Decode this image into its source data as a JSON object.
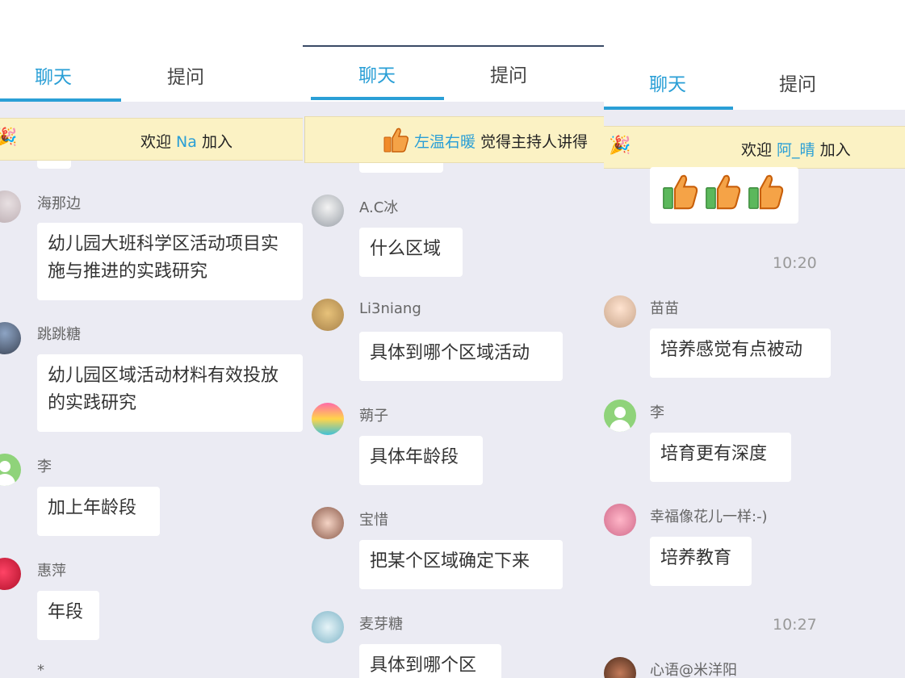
{
  "tabs": {
    "chat": "聊天",
    "ask": "提问"
  },
  "colors": {
    "accent": "#2a9fd6",
    "notice_bg": "#fbf2c4",
    "chat_bg": "#ebebf3"
  },
  "panel1": {
    "notice": {
      "prefix": "欢迎 ",
      "user": "Na",
      "suffix": " 加入"
    },
    "messages": [
      {
        "user": "海那边",
        "text": "幼儿园大班科学区活动项目实施与推进的实践研究"
      },
      {
        "user": "跳跳糖",
        "text": "幼儿园区域活动材料有效投放的实践研究"
      },
      {
        "user": "李",
        "text": "加上年龄段"
      },
      {
        "user": "惠萍",
        "text": "年段"
      },
      {
        "user": "*"
      }
    ]
  },
  "panel2": {
    "notice": {
      "user": "左温右暖",
      "suffix": " 觉得主持人讲得"
    },
    "messages": [
      {
        "user": "A.C冰",
        "text": "什么区域"
      },
      {
        "user": "Li3niang",
        "text": "具体到哪个区域活动"
      },
      {
        "user": "蒴子",
        "text": "具体年龄段"
      },
      {
        "user": "宝惜",
        "text": "把某个区域确定下来"
      },
      {
        "user": "麦芽糖",
        "text": "具体到哪个区域"
      }
    ]
  },
  "panel3": {
    "notice": {
      "prefix": "欢迎 ",
      "user": "阿_晴",
      "suffix": " 加入"
    },
    "times": [
      "10:20",
      "10:27"
    ],
    "messages": [
      {
        "user": "苗苗",
        "text": "培养感觉有点被动"
      },
      {
        "user": "李",
        "text": "培育更有深度"
      },
      {
        "user": "幸福像花儿一样:-)",
        "text": "培养教育"
      },
      {
        "user": "心语@米洋阳"
      }
    ]
  }
}
